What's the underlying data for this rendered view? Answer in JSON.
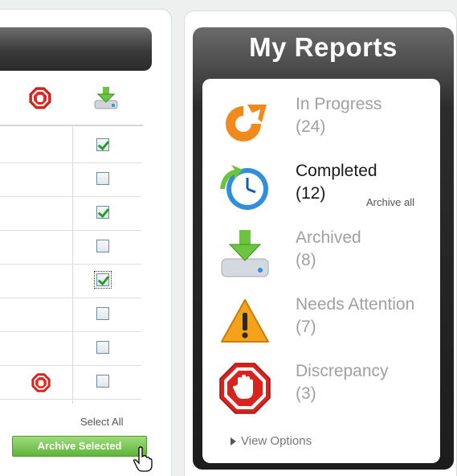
{
  "left_panel": {
    "select_all": "Select All",
    "archive_selected": "Archive Selected",
    "rows": [
      {
        "checked": true,
        "stop_icon": false
      },
      {
        "checked": false,
        "stop_icon": false
      },
      {
        "checked": true,
        "stop_icon": false
      },
      {
        "checked": false,
        "stop_icon": false
      },
      {
        "checked": true,
        "stop_icon": false,
        "focused": true
      },
      {
        "checked": false,
        "stop_icon": false
      },
      {
        "checked": false,
        "stop_icon": false
      },
      {
        "checked": false,
        "stop_icon": true
      }
    ],
    "header_icons": [
      "stop-hand-icon",
      "download-icon"
    ]
  },
  "reports": {
    "title": "My Reports",
    "items": [
      {
        "label": "In Progress",
        "count": "(24)",
        "icon": "refresh-icon"
      },
      {
        "label": "Completed",
        "count": "(12)",
        "icon": "clock-icon",
        "active": true
      },
      {
        "label": "Archived",
        "count": "(8)",
        "icon": "download-icon"
      },
      {
        "label": "Needs Attention",
        "count": "(7)",
        "icon": "warning-icon"
      },
      {
        "label": "Discrepancy",
        "count": "(3)",
        "icon": "stop-hand-icon"
      }
    ],
    "archive_all": "Archive all",
    "view_options": "View Options"
  },
  "colors": {
    "accent_green": "#5fb43b",
    "orange": "#f08a1c",
    "stop_red": "#d8231f",
    "clock_blue": "#2f8fdc"
  }
}
